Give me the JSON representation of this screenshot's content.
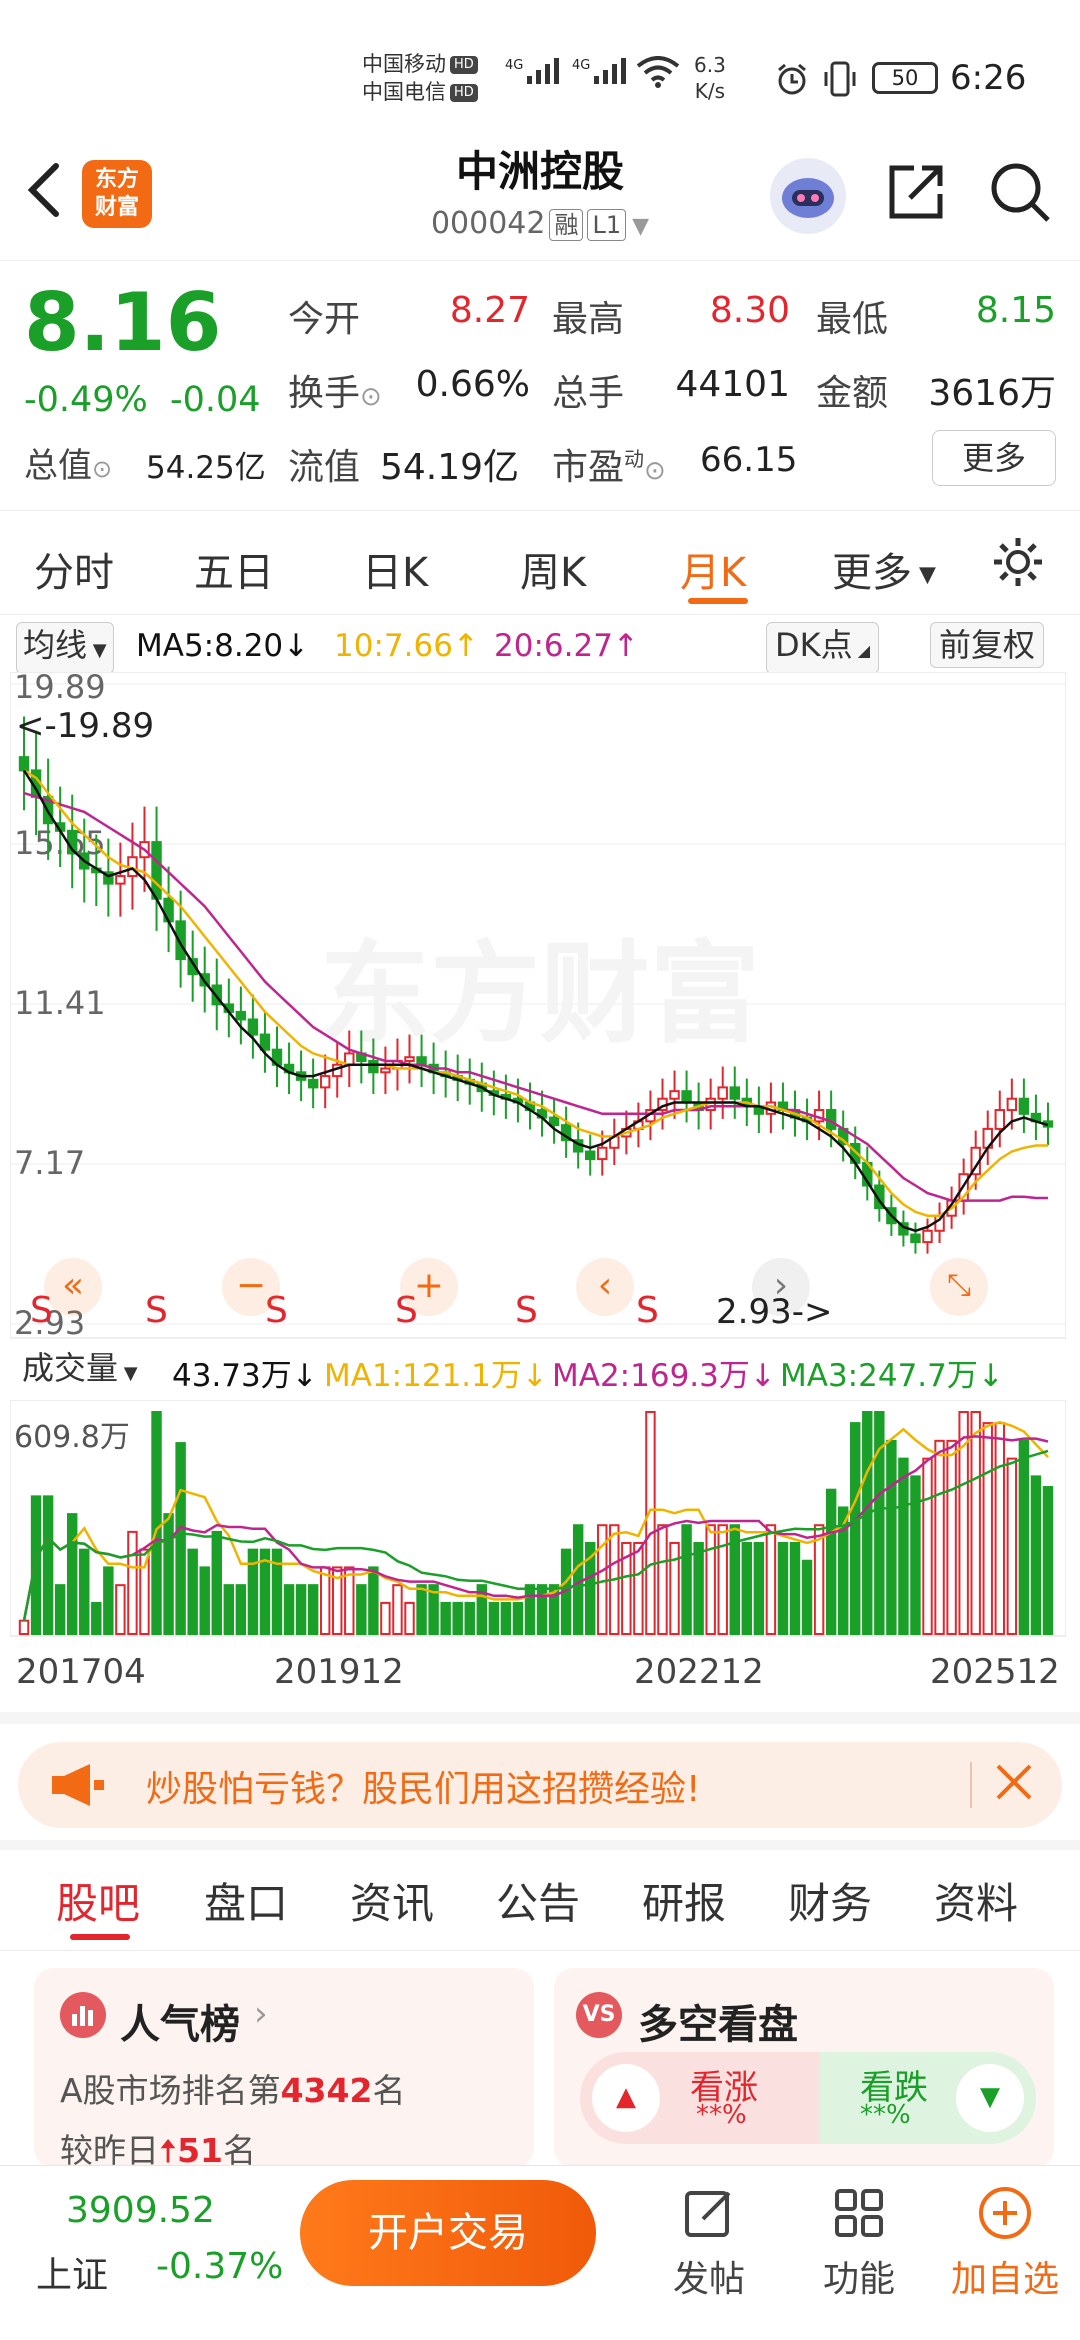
{
  "status_bar": {
    "carrier1": "中国移动",
    "carrier2": "中国电信",
    "hd": "HD",
    "net1": "4G",
    "net2": "4G",
    "wifi": "6",
    "speed_value": "6.3",
    "speed_unit": "K/s",
    "battery": "50",
    "time": "6:26"
  },
  "header": {
    "logo": "东方\n财富",
    "stock_name": "中洲控股",
    "stock_code": "000042",
    "badge_margin": "融",
    "badge_level": "L1"
  },
  "quote": {
    "price": "8.16",
    "change_pct": "-0.49%",
    "change": "-0.04",
    "open_label": "今开",
    "open": "8.27",
    "high_label": "最高",
    "high": "8.30",
    "low_label": "最低",
    "low": "8.15",
    "turnover_label": "换手",
    "turnover": "0.66%",
    "volume_label": "总手",
    "volume": "44101",
    "amount_label": "金额",
    "amount": "3616万",
    "mktcap_label": "总值",
    "mktcap": "54.25亿",
    "float_label": "流值",
    "float_cap": "54.19亿",
    "pe_label": "市盈",
    "pe_sup": "动",
    "pe": "66.15",
    "more_label": "更多"
  },
  "chart_tabs": [
    "分时",
    "五日",
    "日K",
    "周K",
    "月K",
    "更多"
  ],
  "active_chart_tab": "月K",
  "ma_legend": {
    "selector": "均线",
    "ma5": "MA5:8.20↓",
    "ma10": "10:7.66↑",
    "ma20": "20:6.27↑",
    "dk": "DK点",
    "adjust": "前复权"
  },
  "price_axis": [
    "19.89",
    "15.65",
    "11.41",
    "7.17",
    "2.93"
  ],
  "annotations": {
    "high": "<-19.89",
    "low": "2.93->"
  },
  "volume_legend": {
    "selector": "成交量",
    "vol": "43.73万↓",
    "ma1": "MA1:121.1万↓",
    "ma2": "MA2:169.3万↓",
    "ma3": "MA3:247.7万↓",
    "max": "609.8万"
  },
  "date_axis": [
    "201704",
    "201912",
    "202212",
    "202512"
  ],
  "promo": {
    "text": "炒股怕亏钱？股民们用这招攒经验!"
  },
  "bottom_tabs": [
    "股吧",
    "盘口",
    "资讯",
    "公告",
    "研报",
    "财务",
    "资料"
  ],
  "active_bottom_tab": "股吧",
  "popularity": {
    "title": "人气榜",
    "rank_prefix": "A股市场排名第",
    "rank": "4342",
    "rank_suffix": "名",
    "change_prefix": "较昨日",
    "change": "51",
    "change_suffix": "名"
  },
  "sentiment": {
    "title": "多空看盘",
    "bull": "看涨",
    "bull_pct": "**%",
    "bear": "看跌",
    "bear_pct": "**%"
  },
  "bottom_bar": {
    "index_value": "3909.52",
    "index_name": "上证",
    "index_change": "-0.37%",
    "trade": "开户交易",
    "post": "发帖",
    "func": "功能",
    "watch": "加自选"
  },
  "colors": {
    "up": "#e3262d",
    "down": "#1a9f29",
    "accent": "#f26a13",
    "ma5": "#111111",
    "ma10": "#f0b400",
    "ma20": "#c0248e"
  },
  "chart_data": {
    "type": "candlestick",
    "period": "monthly",
    "ylim": [
      2.93,
      19.89
    ],
    "x_ticks": [
      "201704",
      "201912",
      "202212",
      "202512"
    ],
    "close": [
      17.6,
      16.9,
      16.2,
      16.0,
      15.4,
      15.0,
      14.9,
      14.6,
      14.8,
      15.3,
      15.7,
      14.2,
      13.6,
      12.6,
      12.2,
      11.9,
      11.4,
      11.2,
      11.0,
      10.6,
      10.2,
      9.8,
      9.6,
      9.4,
      9.2,
      9.5,
      9.8,
      10.1,
      9.9,
      9.6,
      9.7,
      9.9,
      10.0,
      9.8,
      9.6,
      9.5,
      9.4,
      9.3,
      9.1,
      9.0,
      8.9,
      8.8,
      8.6,
      8.4,
      8.2,
      7.8,
      7.5,
      7.3,
      7.6,
      7.9,
      8.1,
      8.3,
      8.6,
      8.9,
      9.1,
      8.8,
      8.6,
      8.9,
      9.2,
      8.9,
      8.7,
      8.5,
      8.8,
      8.6,
      8.4,
      8.3,
      8.6,
      8.1,
      7.7,
      7.2,
      6.6,
      6.0,
      5.6,
      5.3,
      5.1,
      5.4,
      5.8,
      6.2,
      6.9,
      7.6,
      8.1,
      8.6,
      8.9,
      8.5,
      8.3,
      8.16
    ],
    "ma5": [
      17.6,
      17.1,
      16.5,
      16.0,
      15.5,
      15.2,
      15.0,
      14.8,
      14.9,
      15.0,
      14.7,
      14.2,
      13.6,
      13.0,
      12.5,
      12.0,
      11.6,
      11.2,
      10.8,
      10.5,
      10.1,
      9.8,
      9.6,
      9.5,
      9.5,
      9.6,
      9.7,
      9.8,
      9.8,
      9.8,
      9.8,
      9.8,
      9.8,
      9.7,
      9.6,
      9.5,
      9.4,
      9.3,
      9.2,
      9.0,
      8.9,
      8.8,
      8.6,
      8.4,
      8.1,
      7.9,
      7.7,
      7.6,
      7.7,
      7.9,
      8.1,
      8.3,
      8.5,
      8.7,
      8.8,
      8.8,
      8.8,
      8.8,
      8.8,
      8.8,
      8.7,
      8.7,
      8.6,
      8.5,
      8.4,
      8.3,
      8.1,
      7.9,
      7.6,
      7.2,
      6.7,
      6.2,
      5.8,
      5.5,
      5.4,
      5.5,
      5.7,
      6.1,
      6.6,
      7.1,
      7.6,
      8.0,
      8.3,
      8.4,
      8.3,
      8.2
    ],
    "ma10": [
      17.6,
      17.4,
      17.0,
      16.6,
      16.2,
      15.9,
      15.6,
      15.3,
      15.1,
      15.0,
      14.9,
      14.6,
      14.3,
      14.0,
      13.6,
      13.2,
      12.8,
      12.4,
      12.0,
      11.6,
      11.2,
      10.9,
      10.6,
      10.3,
      10.1,
      10.0,
      9.9,
      9.8,
      9.8,
      9.8,
      9.8,
      9.7,
      9.7,
      9.7,
      9.6,
      9.6,
      9.5,
      9.4,
      9.3,
      9.2,
      9.1,
      9.0,
      8.8,
      8.7,
      8.5,
      8.3,
      8.1,
      8.0,
      7.9,
      7.9,
      8.0,
      8.1,
      8.2,
      8.4,
      8.5,
      8.6,
      8.7,
      8.8,
      8.8,
      8.8,
      8.8,
      8.7,
      8.7,
      8.6,
      8.5,
      8.4,
      8.2,
      8.0,
      7.8,
      7.5,
      7.2,
      6.8,
      6.4,
      6.1,
      5.9,
      5.8,
      5.8,
      6.0,
      6.3,
      6.7,
      7.0,
      7.3,
      7.5,
      7.6,
      7.66,
      7.66
    ],
    "ma20": [
      17.0,
      16.9,
      16.8,
      16.7,
      16.6,
      16.5,
      16.3,
      16.1,
      15.9,
      15.7,
      15.5,
      15.2,
      14.9,
      14.6,
      14.3,
      14.0,
      13.6,
      13.2,
      12.8,
      12.4,
      12.0,
      11.7,
      11.4,
      11.1,
      10.8,
      10.6,
      10.4,
      10.2,
      10.1,
      10.0,
      9.9,
      9.9,
      9.8,
      9.8,
      9.7,
      9.7,
      9.6,
      9.6,
      9.5,
      9.4,
      9.3,
      9.2,
      9.1,
      9.0,
      8.9,
      8.8,
      8.7,
      8.6,
      8.5,
      8.5,
      8.5,
      8.5,
      8.5,
      8.5,
      8.6,
      8.6,
      8.6,
      8.7,
      8.7,
      8.7,
      8.7,
      8.7,
      8.7,
      8.6,
      8.6,
      8.5,
      8.4,
      8.3,
      8.1,
      7.9,
      7.7,
      7.4,
      7.1,
      6.8,
      6.6,
      6.4,
      6.3,
      6.2,
      6.2,
      6.2,
      6.2,
      6.2,
      6.3,
      6.3,
      6.27,
      6.27
    ],
    "volume_max": "609.8万"
  }
}
